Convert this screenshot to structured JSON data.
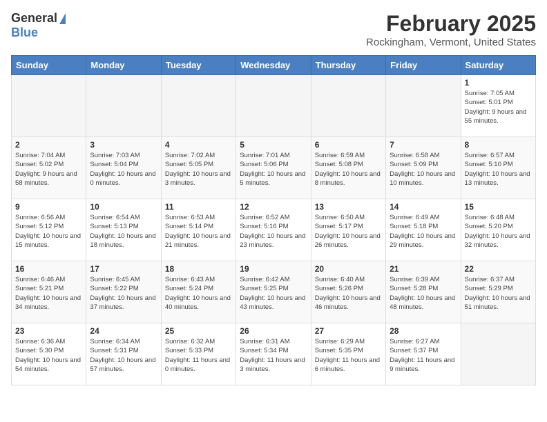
{
  "header": {
    "logo_line1": "General",
    "logo_line2": "Blue",
    "title": "February 2025",
    "subtitle": "Rockingham, Vermont, United States"
  },
  "weekdays": [
    "Sunday",
    "Monday",
    "Tuesday",
    "Wednesday",
    "Thursday",
    "Friday",
    "Saturday"
  ],
  "weeks": [
    [
      {
        "day": "",
        "info": ""
      },
      {
        "day": "",
        "info": ""
      },
      {
        "day": "",
        "info": ""
      },
      {
        "day": "",
        "info": ""
      },
      {
        "day": "",
        "info": ""
      },
      {
        "day": "",
        "info": ""
      },
      {
        "day": "1",
        "info": "Sunrise: 7:05 AM\nSunset: 5:01 PM\nDaylight: 9 hours and 55 minutes."
      }
    ],
    [
      {
        "day": "2",
        "info": "Sunrise: 7:04 AM\nSunset: 5:02 PM\nDaylight: 9 hours and 58 minutes."
      },
      {
        "day": "3",
        "info": "Sunrise: 7:03 AM\nSunset: 5:04 PM\nDaylight: 10 hours and 0 minutes."
      },
      {
        "day": "4",
        "info": "Sunrise: 7:02 AM\nSunset: 5:05 PM\nDaylight: 10 hours and 3 minutes."
      },
      {
        "day": "5",
        "info": "Sunrise: 7:01 AM\nSunset: 5:06 PM\nDaylight: 10 hours and 5 minutes."
      },
      {
        "day": "6",
        "info": "Sunrise: 6:59 AM\nSunset: 5:08 PM\nDaylight: 10 hours and 8 minutes."
      },
      {
        "day": "7",
        "info": "Sunrise: 6:58 AM\nSunset: 5:09 PM\nDaylight: 10 hours and 10 minutes."
      },
      {
        "day": "8",
        "info": "Sunrise: 6:57 AM\nSunset: 5:10 PM\nDaylight: 10 hours and 13 minutes."
      }
    ],
    [
      {
        "day": "9",
        "info": "Sunrise: 6:56 AM\nSunset: 5:12 PM\nDaylight: 10 hours and 15 minutes."
      },
      {
        "day": "10",
        "info": "Sunrise: 6:54 AM\nSunset: 5:13 PM\nDaylight: 10 hours and 18 minutes."
      },
      {
        "day": "11",
        "info": "Sunrise: 6:53 AM\nSunset: 5:14 PM\nDaylight: 10 hours and 21 minutes."
      },
      {
        "day": "12",
        "info": "Sunrise: 6:52 AM\nSunset: 5:16 PM\nDaylight: 10 hours and 23 minutes."
      },
      {
        "day": "13",
        "info": "Sunrise: 6:50 AM\nSunset: 5:17 PM\nDaylight: 10 hours and 26 minutes."
      },
      {
        "day": "14",
        "info": "Sunrise: 6:49 AM\nSunset: 5:18 PM\nDaylight: 10 hours and 29 minutes."
      },
      {
        "day": "15",
        "info": "Sunrise: 6:48 AM\nSunset: 5:20 PM\nDaylight: 10 hours and 32 minutes."
      }
    ],
    [
      {
        "day": "16",
        "info": "Sunrise: 6:46 AM\nSunset: 5:21 PM\nDaylight: 10 hours and 34 minutes."
      },
      {
        "day": "17",
        "info": "Sunrise: 6:45 AM\nSunset: 5:22 PM\nDaylight: 10 hours and 37 minutes."
      },
      {
        "day": "18",
        "info": "Sunrise: 6:43 AM\nSunset: 5:24 PM\nDaylight: 10 hours and 40 minutes."
      },
      {
        "day": "19",
        "info": "Sunrise: 6:42 AM\nSunset: 5:25 PM\nDaylight: 10 hours and 43 minutes."
      },
      {
        "day": "20",
        "info": "Sunrise: 6:40 AM\nSunset: 5:26 PM\nDaylight: 10 hours and 46 minutes."
      },
      {
        "day": "21",
        "info": "Sunrise: 6:39 AM\nSunset: 5:28 PM\nDaylight: 10 hours and 48 minutes."
      },
      {
        "day": "22",
        "info": "Sunrise: 6:37 AM\nSunset: 5:29 PM\nDaylight: 10 hours and 51 minutes."
      }
    ],
    [
      {
        "day": "23",
        "info": "Sunrise: 6:36 AM\nSunset: 5:30 PM\nDaylight: 10 hours and 54 minutes."
      },
      {
        "day": "24",
        "info": "Sunrise: 6:34 AM\nSunset: 5:31 PM\nDaylight: 10 hours and 57 minutes."
      },
      {
        "day": "25",
        "info": "Sunrise: 6:32 AM\nSunset: 5:33 PM\nDaylight: 11 hours and 0 minutes."
      },
      {
        "day": "26",
        "info": "Sunrise: 6:31 AM\nSunset: 5:34 PM\nDaylight: 11 hours and 3 minutes."
      },
      {
        "day": "27",
        "info": "Sunrise: 6:29 AM\nSunset: 5:35 PM\nDaylight: 11 hours and 6 minutes."
      },
      {
        "day": "28",
        "info": "Sunrise: 6:27 AM\nSunset: 5:37 PM\nDaylight: 11 hours and 9 minutes."
      },
      {
        "day": "",
        "info": ""
      }
    ]
  ]
}
